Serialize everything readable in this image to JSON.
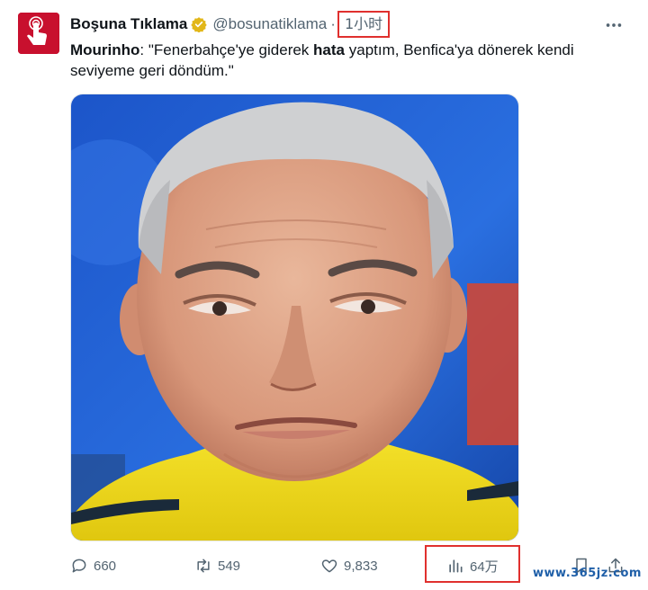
{
  "author": {
    "name": "Boşuna Tıklama",
    "handle": "@bosunatiklama",
    "separator": "·",
    "time": "1小时"
  },
  "tweet": {
    "bold_lead": "Mourinho",
    "text_a": ": \"Fenerbahçe'ye giderek ",
    "bold_word": "hata",
    "text_b": " yaptım, Benfica'ya dönerek kendi seviyeme geri döndüm.\""
  },
  "media": {
    "icon": "photo-of-man"
  },
  "actions": {
    "replies": "660",
    "reposts": "549",
    "likes": "9,833",
    "views": "64万"
  },
  "icons": {
    "more": "more-icon",
    "verified": "verified-badge-icon",
    "reply": "reply-icon",
    "repost": "repost-icon",
    "like": "like-icon",
    "views": "views-icon",
    "bookmark": "bookmark-icon",
    "share": "share-icon"
  },
  "colors": {
    "brand": "#c8102e",
    "highlight_box": "#e0302e",
    "muted_text": "#536471",
    "verified_gold": "#e2b719"
  },
  "watermark": "www.365jz.com"
}
